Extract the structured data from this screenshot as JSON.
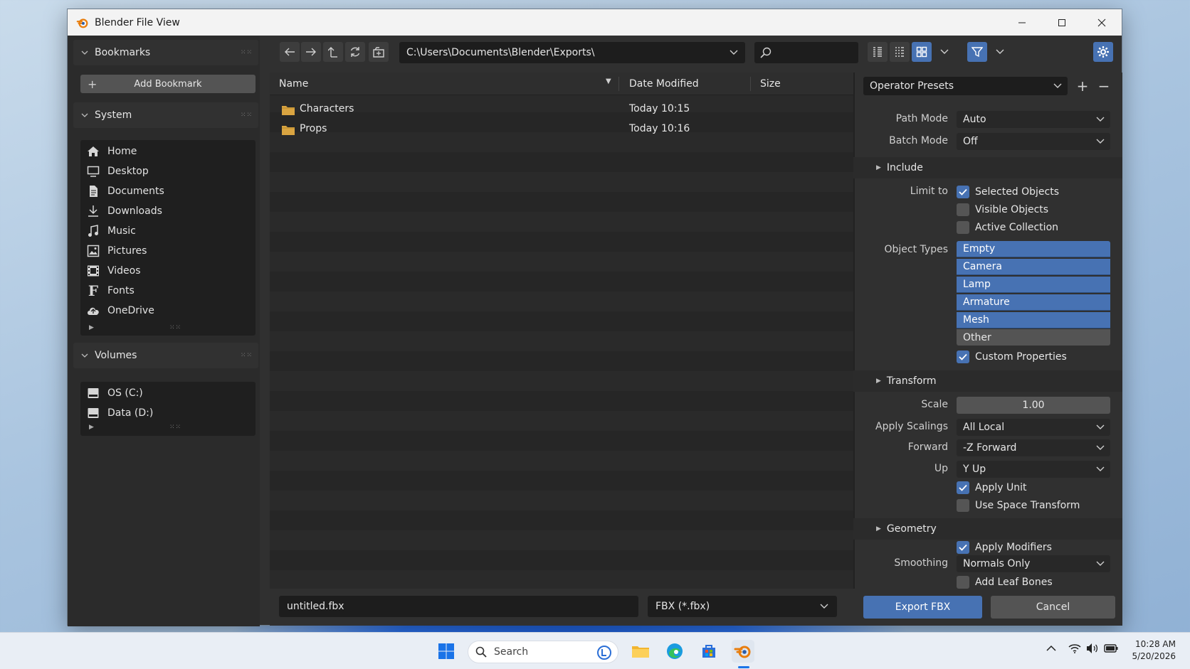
{
  "window": {
    "title": "Blender File View"
  },
  "sidebar": {
    "bookmarks_header": "Bookmarks",
    "add_bookmark": "Add Bookmark",
    "system_header": "System",
    "system_items": [
      {
        "label": "Home",
        "icon": "home-icon"
      },
      {
        "label": "Desktop",
        "icon": "desktop-icon"
      },
      {
        "label": "Documents",
        "icon": "documents-icon"
      },
      {
        "label": "Downloads",
        "icon": "downloads-icon"
      },
      {
        "label": "Music",
        "icon": "music-icon"
      },
      {
        "label": "Pictures",
        "icon": "pictures-icon"
      },
      {
        "label": "Videos",
        "icon": "videos-icon"
      },
      {
        "label": "Fonts",
        "icon": "fonts-icon"
      },
      {
        "label": "OneDrive",
        "icon": "cloud-icon"
      }
    ],
    "volumes_header": "Volumes",
    "volumes_items": [
      {
        "label": "OS (C:)",
        "icon": "drive-icon"
      },
      {
        "label": "Data (D:)",
        "icon": "drive-icon"
      }
    ]
  },
  "toolbar": {
    "path": "C:\\Users\\Documents\\Blender\\Exports\\",
    "search_value": ""
  },
  "file_list": {
    "columns": [
      "Name",
      "Date Modified",
      "Size"
    ],
    "rows": [
      {
        "name": "Characters",
        "date": "Today 10:15",
        "size": ""
      },
      {
        "name": "Props",
        "date": "Today 10:16",
        "size": ""
      }
    ]
  },
  "bottom": {
    "filename": "untitled.fbx",
    "filetype": "FBX (*.fbx)",
    "export_label": "Export FBX",
    "cancel_label": "Cancel"
  },
  "props": {
    "operator_presets": "Operator Presets",
    "path_mode_label": "Path Mode",
    "path_mode_value": "Auto",
    "batch_mode_label": "Batch Mode",
    "batch_mode_value": "Off",
    "include_header": "Include",
    "limit_to_label": "Limit to",
    "selected_objects": "Selected Objects",
    "visible_objects": "Visible Objects",
    "active_collection": "Active Collection",
    "object_types_label": "Object Types",
    "object_types": [
      {
        "label": "Empty",
        "selected": true
      },
      {
        "label": "Camera",
        "selected": true
      },
      {
        "label": "Lamp",
        "selected": true
      },
      {
        "label": "Armature",
        "selected": true
      },
      {
        "label": "Mesh",
        "selected": true
      },
      {
        "label": "Other",
        "selected": false
      }
    ],
    "custom_properties": "Custom Properties",
    "transform_header": "Transform",
    "scale_label": "Scale",
    "scale_value": "1.00",
    "apply_scalings_label": "Apply Scalings",
    "apply_scalings_value": "All Local",
    "forward_label": "Forward",
    "forward_value": "-Z Forward",
    "up_label": "Up",
    "up_value": "Y Up",
    "apply_unit": "Apply Unit",
    "use_space_transform": "Use Space Transform",
    "geometry_header": "Geometry",
    "apply_modifiers": "Apply Modifiers",
    "smoothing_label": "Smoothing",
    "smoothing_value": "Normals Only",
    "add_leaf_bones": "Add Leaf Bones"
  },
  "taskbar": {
    "search_label": "Search",
    "time": "10:28 AM",
    "date": "5/20/2026"
  },
  "colors": {
    "accent": "#4772b3",
    "folder": "#d9a441",
    "blender_orange": "#e87d0d"
  }
}
